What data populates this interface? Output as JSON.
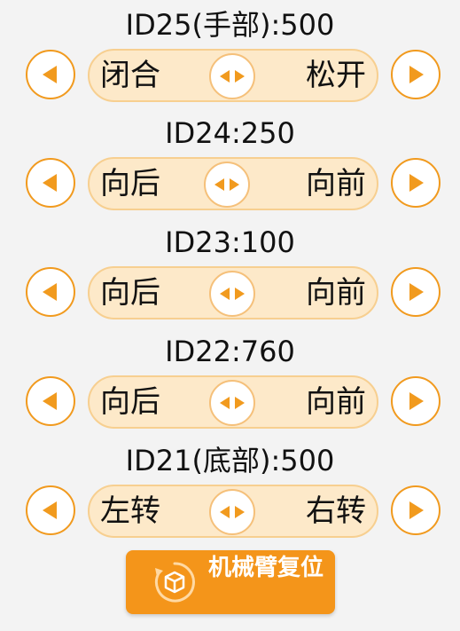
{
  "accent_color": "#f19a1e",
  "track_color": "#fde9c9",
  "servos": [
    {
      "title": "ID25(手部):500",
      "left_label": "闭合",
      "right_label": "松开"
    },
    {
      "title": "ID24:250",
      "left_label": "向后",
      "right_label": "向前"
    },
    {
      "title": "ID23:100",
      "left_label": "向后",
      "right_label": "向前"
    },
    {
      "title": "ID22:760",
      "left_label": "向后",
      "right_label": "向前"
    },
    {
      "title": "ID21(底部):500",
      "left_label": "左转",
      "right_label": "右转"
    }
  ],
  "reset_button": {
    "label": "机械臂复位",
    "icon": "cube-reset-icon"
  }
}
